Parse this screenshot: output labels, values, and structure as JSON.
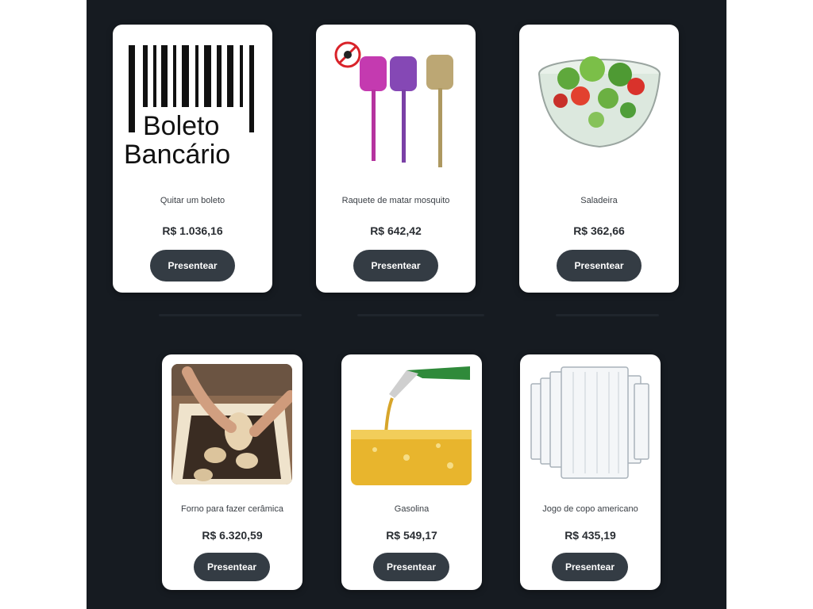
{
  "products": [
    {
      "title": "Quitar um boleto",
      "price": "R$ 1.036,16",
      "button": "Presentear",
      "image_text": [
        "Boleto",
        "Bancário"
      ]
    },
    {
      "title": "Raquete de matar mosquito",
      "price": "R$ 642,42",
      "button": "Presentear"
    },
    {
      "title": "Saladeira",
      "price": "R$ 362,66",
      "button": "Presentear"
    },
    {
      "title": "Forno para fazer cerâmica",
      "price": "R$ 6.320,59",
      "button": "Presentear"
    },
    {
      "title": "Gasolina",
      "price": "R$ 549,17",
      "button": "Presentear"
    },
    {
      "title": "Jogo de copo americano",
      "price": "R$ 435,19",
      "button": "Presentear"
    }
  ],
  "colors": {
    "background": "#161b21",
    "card": "#ffffff",
    "button": "#343c44"
  }
}
